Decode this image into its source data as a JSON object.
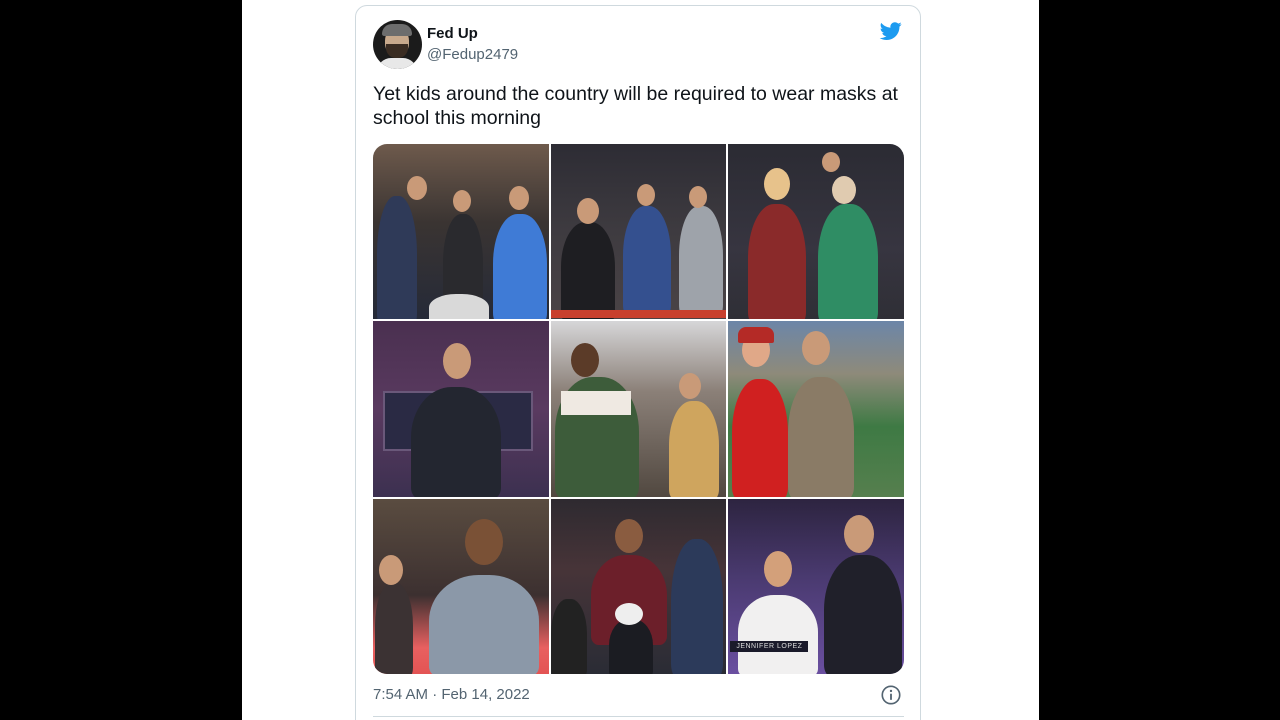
{
  "tweet": {
    "display_name": "Fed Up",
    "handle": "@Fedup2479",
    "text": "Yet kids around the country will be required to wear masks at school this morning",
    "timestamp": "7:54 AM · Feb 14, 2022",
    "brand_color": "#1d9bf0"
  },
  "photos": {
    "caption_label": "JENNIFER LOPEZ"
  },
  "icons": {
    "brand": "twitter-bird-icon",
    "info": "info-icon"
  }
}
